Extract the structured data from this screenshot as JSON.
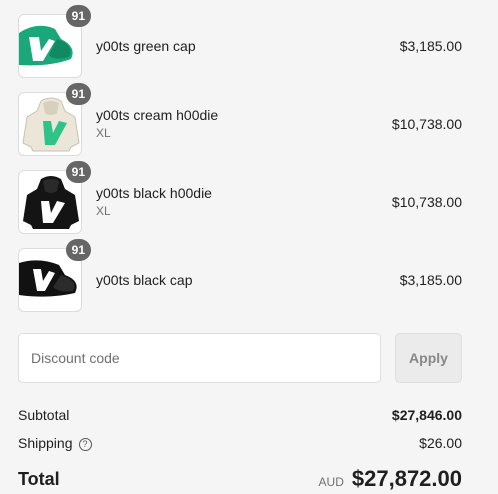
{
  "cart": {
    "items": [
      {
        "quantity": "91",
        "name": "y00ts green cap",
        "variant": "",
        "price": "$3,185.00",
        "thumbnail_icon": "green-cap-icon",
        "color": "#1aa87a"
      },
      {
        "quantity": "91",
        "name": "y00ts cream h00die",
        "variant": "XL",
        "price": "$10,738.00",
        "thumbnail_icon": "cream-hoodie-icon",
        "color": "#ece6d8"
      },
      {
        "quantity": "91",
        "name": "y00ts black h00die",
        "variant": "XL",
        "price": "$10,738.00",
        "thumbnail_icon": "black-hoodie-icon",
        "color": "#141414"
      },
      {
        "quantity": "91",
        "name": "y00ts black cap",
        "variant": "",
        "price": "$3,185.00",
        "thumbnail_icon": "black-cap-icon",
        "color": "#111111"
      }
    ]
  },
  "discount": {
    "placeholder": "Discount code",
    "value": "",
    "apply_label": "Apply"
  },
  "totals": {
    "subtotal_label": "Subtotal",
    "subtotal_value": "$27,846.00",
    "shipping_label": "Shipping",
    "shipping_help_icon": "question-circle-icon",
    "shipping_value": "$26.00",
    "total_label": "Total",
    "currency": "AUD",
    "total_value": "$27,872.00"
  },
  "colors": {
    "background": "#f5f5f5",
    "badge": "#666666",
    "logo_green": "#2fc38a"
  }
}
